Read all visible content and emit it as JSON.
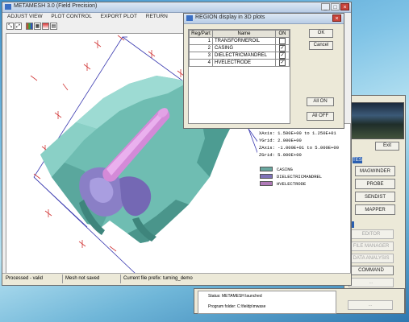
{
  "main_window": {
    "title": "METAMESH 3.0 (Field Precision)",
    "menu": [
      "ADJUST VIEW",
      "PLOT CONTROL",
      "EXPORT PLOT",
      "RETURN"
    ],
    "status": [
      "Processed - valid",
      "Mesh not saved",
      "Current file prefix: turning_demo"
    ],
    "info_lines": [
      "XAxis:  1.500E+00 to  1.250E+01",
      "YGrid:  2.000E+00",
      "ZAxis: -1.000E+01 to  5.000E+00",
      "ZGrid:  5.000E+00"
    ],
    "legend": [
      {
        "label": "CASING",
        "color": "#6aa8a0"
      },
      {
        "label": "DIELECTRICMANDREL",
        "color": "#7f72b8"
      },
      {
        "label": "HVELECTRODE",
        "color": "#b07ab8"
      }
    ]
  },
  "dialog": {
    "title": "REGION display in 3D plots",
    "columns": [
      "Reg/Part",
      "Name",
      "ON"
    ],
    "rows": [
      {
        "num": "1",
        "name": "TRANSFORMEROIL",
        "checked": false
      },
      {
        "num": "2",
        "name": "CASING",
        "checked": true
      },
      {
        "num": "3",
        "name": "DIELECTRICMANDREL",
        "checked": true
      },
      {
        "num": "4",
        "name": "HVELECTRODE",
        "checked": true
      }
    ],
    "ok": "OK",
    "cancel": "Cancel",
    "all_on": "All ON",
    "all_off": "All OFF"
  },
  "launcher": {
    "exit": "Exit",
    "tools_head": "TES",
    "tools": [
      "MAGWINDER",
      "PROBE",
      "SENDIST",
      "MAPPER"
    ],
    "disabled_head": "2",
    "disabled": [
      "EDITOR",
      "FILE MANAGER",
      "DATA ANALYSIS"
    ],
    "command": "COMMAND",
    "extra": [
      "...",
      "...",
      "...",
      "..."
    ],
    "status": "Status: METAMESH launched",
    "program_folder": "Program folder: C:\\fieldp\\mwase"
  },
  "colors": {
    "casing": "#6fbdb2",
    "mandrel": "#8a7fc6",
    "electrode": "#d48ad8",
    "axes": "#3a3ab0",
    "grid_marks": "#d23a3a"
  }
}
